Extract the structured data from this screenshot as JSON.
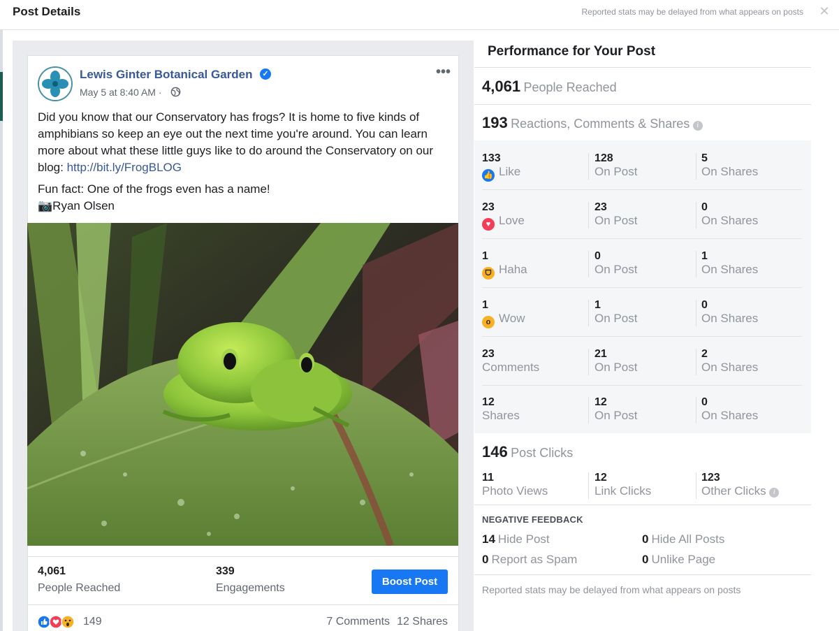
{
  "header": {
    "title": "Post Details",
    "note": "Reported stats may be delayed from what appears on posts",
    "close": "✕"
  },
  "post": {
    "page_name": "Lewis Ginter Botanical Garden",
    "date": "May 5 at 8:40 AM ·",
    "text_main": "Did you know that our Conservatory has frogs? It is home to five kinds of amphibians so keep an eye out the next time you're around. You can learn more about what these little guys like to do around the Conservatory on our blog: ",
    "link": "http://bit.ly/FrogBLOG",
    "fun_fact": "Fun fact: One of the frogs even has a name!",
    "credit": "📷Ryan Olsen",
    "more": "•••",
    "people_reached_num": "4,061",
    "people_reached_label": "People Reached",
    "engagements_num": "339",
    "engagements_label": "Engagements",
    "boost_label": "Boost Post",
    "reactions_count": "149",
    "comments": "7 Comments",
    "shares": "12 Shares"
  },
  "performance": {
    "title": "Performance for Your Post",
    "reached_num": "4,061",
    "reached_label": "People Reached",
    "rcs_num": "193",
    "rcs_label": "Reactions, Comments & Shares",
    "on_post": "On Post",
    "on_shares": "On Shares",
    "rows": [
      {
        "num": "133",
        "label": "Like",
        "post": "128",
        "shares": "5"
      },
      {
        "num": "23",
        "label": "Love",
        "post": "23",
        "shares": "0"
      },
      {
        "num": "1",
        "label": "Haha",
        "post": "0",
        "shares": "1"
      },
      {
        "num": "1",
        "label": "Wow",
        "post": "1",
        "shares": "0"
      },
      {
        "num": "23",
        "label": "Comments",
        "post": "21",
        "shares": "2"
      },
      {
        "num": "12",
        "label": "Shares",
        "post": "12",
        "shares": "0"
      }
    ],
    "clicks_num": "146",
    "clicks_label": "Post Clicks",
    "photo_views_num": "11",
    "photo_views_label": "Photo Views",
    "link_clicks_num": "12",
    "link_clicks_label": "Link Clicks",
    "other_clicks_num": "123",
    "other_clicks_label": "Other Clicks",
    "negative_title": "NEGATIVE FEEDBACK",
    "hide_post_num": "14",
    "hide_post_label": "Hide Post",
    "hide_all_num": "0",
    "hide_all_label": "Hide All Posts",
    "spam_num": "0",
    "spam_label": "Report as Spam",
    "unlike_num": "0",
    "unlike_label": "Unlike Page",
    "footer_note": "Reported stats may be delayed from what appears on posts"
  },
  "colors": {
    "accent": "#1877f2",
    "link": "#385898",
    "muted": "#90949c"
  }
}
